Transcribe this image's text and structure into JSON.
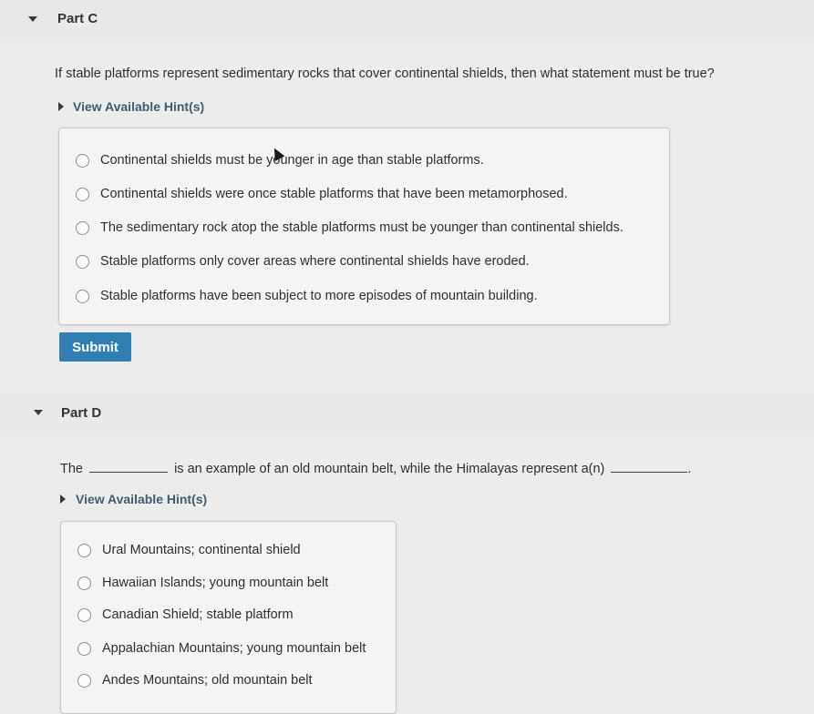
{
  "part_c": {
    "title": "Part C",
    "question": "If stable platforms represent sedimentary rocks that cover continental shields, then what statement must be true?",
    "hint_link": "View Available Hint(s)",
    "options": [
      "Continental shields must be younger in age than stable platforms.",
      "Continental shields were once stable platforms that have been metamorphosed.",
      "The sedimentary rock atop the stable platforms must be younger than continental shields.",
      "Stable platforms only cover areas where continental shields have eroded.",
      "Stable platforms have been subject to more episodes of mountain building."
    ],
    "submit_label": "Submit"
  },
  "part_d": {
    "title": "Part D",
    "question_start": "The",
    "question_middle": "is an example of an old mountain belt, while the Himalayas represent a(n)",
    "question_end": ".",
    "hint_link": "View Available Hint(s)",
    "options": [
      "Ural Mountains; continental shield",
      "Hawaiian Islands; young mountain belt",
      "Canadian Shield; stable platform",
      "Appalachian Mountains; young mountain belt",
      "Andes Mountains; old mountain belt"
    ]
  },
  "colors": {
    "submit_button": "#2f7fb3",
    "hint_link": "#3d5d73",
    "page_background": "#ececea"
  }
}
